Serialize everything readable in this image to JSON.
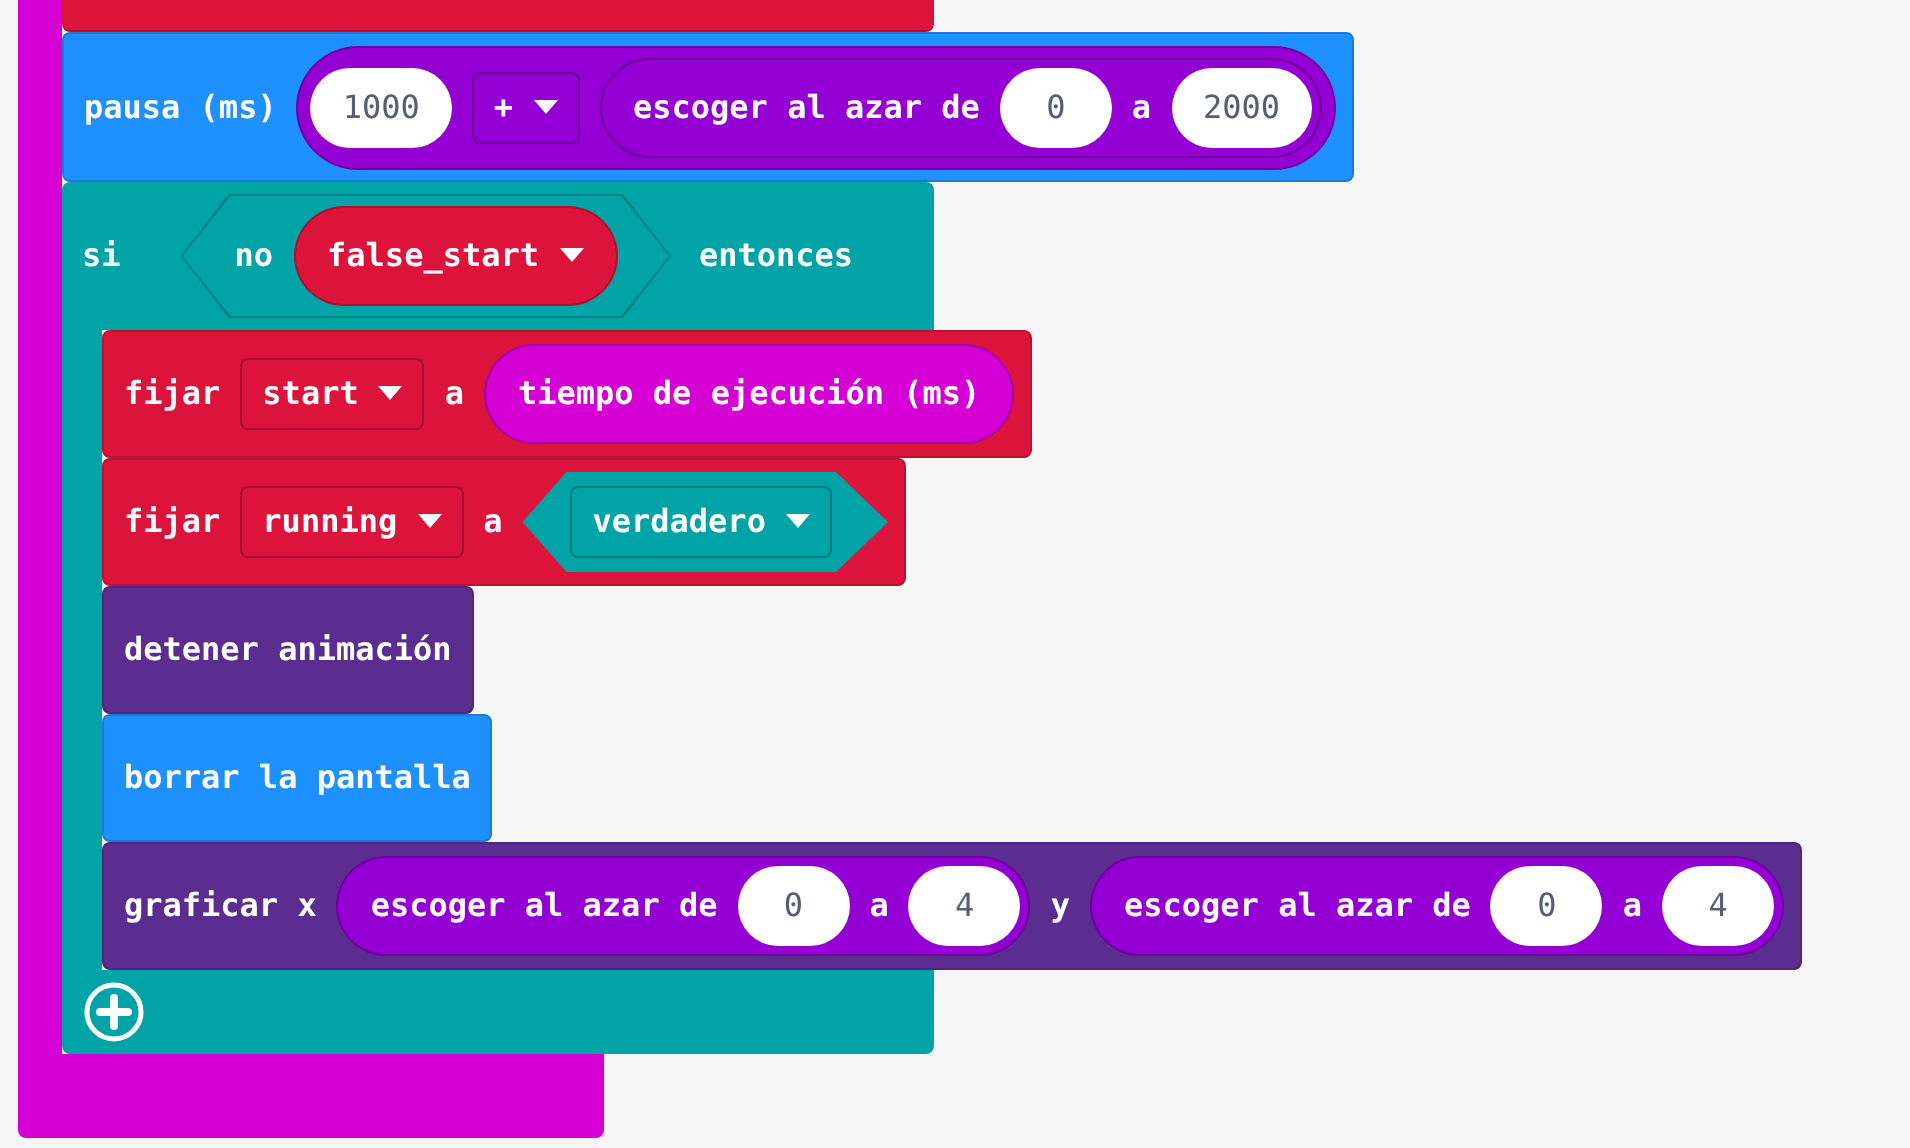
{
  "pause": {
    "label": "pausa (ms)",
    "value": "1000",
    "operator": "+",
    "random": {
      "label": "escoger al azar de",
      "from": "0",
      "to_label": "a",
      "to": "2000"
    }
  },
  "if_block": {
    "label": "si",
    "condition": {
      "not_label": "no",
      "variable": "false_start"
    },
    "then_label": "entonces",
    "body": [
      {
        "kind": "set",
        "label": "fijar",
        "variable": "start",
        "to_label": "a",
        "value": {
          "kind": "reporter",
          "text": "tiempo de ejecución (ms)"
        }
      },
      {
        "kind": "set",
        "label": "fijar",
        "variable": "running",
        "to_label": "a",
        "value": {
          "kind": "boolean",
          "text": "verdadero"
        }
      },
      {
        "kind": "simple",
        "label": "detener animación",
        "color": "#5c2d91"
      },
      {
        "kind": "simple",
        "label": "borrar la pantalla",
        "color": "#1e90ff"
      },
      {
        "kind": "plot",
        "label": "graficar x",
        "x": {
          "label": "escoger al azar de",
          "from": "0",
          "to_label": "a",
          "to": "4"
        },
        "y_label": "y",
        "y": {
          "label": "escoger al azar de",
          "from": "0",
          "to_label": "a",
          "to": "4"
        }
      }
    ]
  }
}
